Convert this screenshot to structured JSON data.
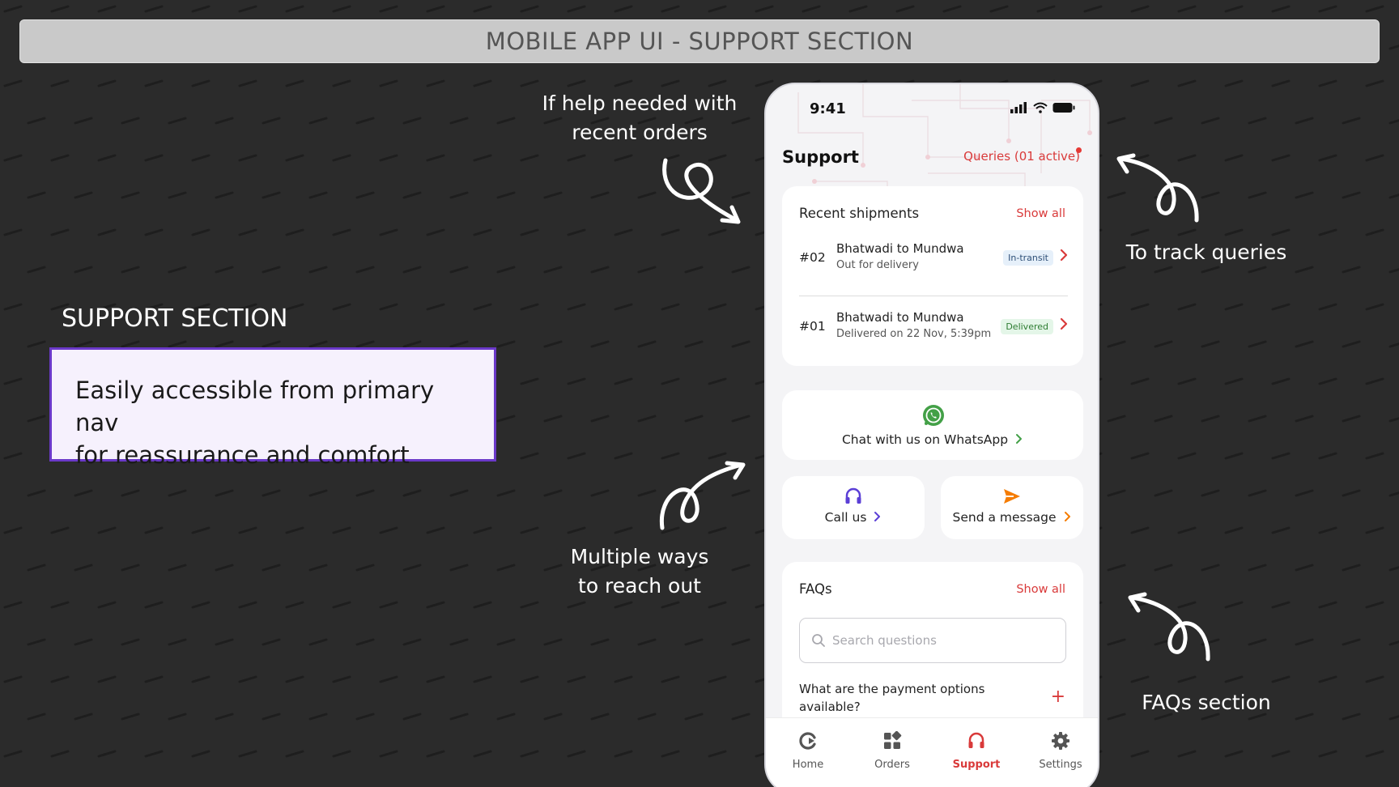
{
  "banner": {
    "title": "MOBILE APP UI - SUPPORT SECTION"
  },
  "left_panel": {
    "heading": "SUPPORT SECTION",
    "description_line1": "Easily accessible from primary nav",
    "description_line2": "for reassurance and comfort"
  },
  "annotations": {
    "recent_orders_line1": "If help needed with",
    "recent_orders_line2": "recent orders",
    "track_queries": "To track queries",
    "reach_out_line1": "Multiple ways",
    "reach_out_line2": "to reach out",
    "faqs": "FAQs section"
  },
  "phone": {
    "status": {
      "time": "9:41",
      "icons": [
        "signal-icon",
        "wifi-icon",
        "battery-icon"
      ]
    },
    "header": {
      "title": "Support",
      "queries_link": "Queries (01 active)"
    },
    "shipments": {
      "heading": "Recent shipments",
      "show_all": "Show all",
      "rows": [
        {
          "number": "#02",
          "route": "Bhatwadi to Mundwa",
          "status_text": "Out for delivery",
          "badge": "In-transit"
        },
        {
          "number": "#01",
          "route": "Bhatwadi to Mundwa",
          "status_text": "Delivered on 22 Nov, 5:39pm",
          "badge": "Delivered"
        }
      ]
    },
    "whatsapp": {
      "label": "Chat with us on WhatsApp",
      "icon": "whatsapp-icon"
    },
    "call": {
      "label": "Call us",
      "icon": "headset-icon"
    },
    "message": {
      "label": "Send a message",
      "icon": "send-icon"
    },
    "faqs": {
      "heading": "FAQs",
      "show_all": "Show all",
      "search_placeholder": "Search questions",
      "question_line1": "What are the payment options",
      "question_line2": "available?"
    },
    "nav": {
      "items": [
        {
          "label": "Home",
          "icon": "home-icon"
        },
        {
          "label": "Orders",
          "icon": "orders-icon"
        },
        {
          "label": "Support",
          "icon": "support-icon",
          "active": true
        },
        {
          "label": "Settings",
          "icon": "settings-icon"
        }
      ]
    }
  },
  "colors": {
    "background": "#2b2b2b",
    "accent_red": "#d93a3a",
    "whatsapp_green": "#43a047",
    "call_purple": "#5b3fd6",
    "message_orange": "#f57c00",
    "desc_border": "#6b39c9"
  }
}
